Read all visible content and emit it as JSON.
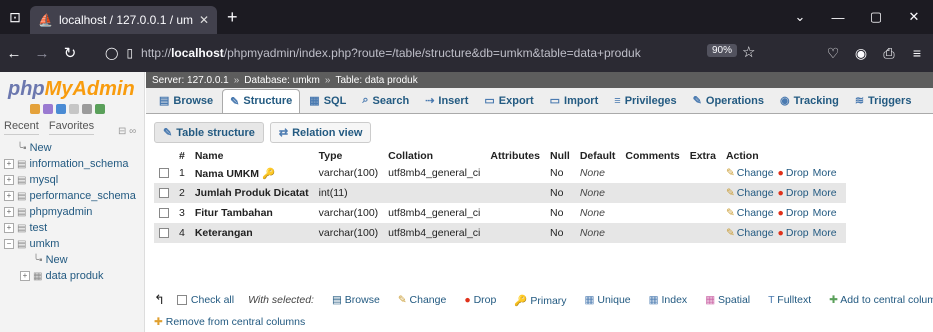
{
  "browser": {
    "tab_title": "localhost / 127.0.0.1 / umkm / d",
    "url_prefix": "http://",
    "url_host": "localhost",
    "url_path": "/phpmyadmin/index.php?route=/table/structure&db=umkm&table=data+produk",
    "zoom": "90%"
  },
  "sidebar": {
    "logo_a": "php",
    "logo_b": "MyAdmin",
    "recent": "Recent",
    "favorites": "Favorites",
    "items": [
      {
        "label": "New"
      },
      {
        "label": "information_schema"
      },
      {
        "label": "mysql"
      },
      {
        "label": "performance_schema"
      },
      {
        "label": "phpmyadmin"
      },
      {
        "label": "test"
      },
      {
        "label": "umkm"
      }
    ],
    "sub": [
      {
        "label": "New"
      },
      {
        "label": "data produk"
      }
    ]
  },
  "breadcrumb": {
    "server": "Server: 127.0.0.1",
    "database": "Database: umkm",
    "table": "Table: data produk"
  },
  "menu": {
    "browse": "Browse",
    "structure": "Structure",
    "sql": "SQL",
    "search": "Search",
    "insert": "Insert",
    "export": "Export",
    "import": "Import",
    "privileges": "Privileges",
    "operations": "Operations",
    "tracking": "Tracking",
    "triggers": "Triggers"
  },
  "subtabs": {
    "table_structure": "Table structure",
    "relation_view": "Relation view"
  },
  "columns": {
    "num": "#",
    "name": "Name",
    "type": "Type",
    "collation": "Collation",
    "attributes": "Attributes",
    "null": "Null",
    "default": "Default",
    "comments": "Comments",
    "extra": "Extra",
    "action": "Action"
  },
  "rows": [
    {
      "n": "1",
      "name": "Nama UMKM",
      "type": "varchar(100)",
      "collation": "utf8mb4_general_ci",
      "null": "No",
      "default": "None"
    },
    {
      "n": "2",
      "name": "Jumlah Produk Dicatat",
      "type": "int(11)",
      "collation": "",
      "null": "No",
      "default": "None"
    },
    {
      "n": "3",
      "name": "Fitur Tambahan",
      "type": "varchar(100)",
      "collation": "utf8mb4_general_ci",
      "null": "No",
      "default": "None"
    },
    {
      "n": "4",
      "name": "Keterangan",
      "type": "varchar(100)",
      "collation": "utf8mb4_general_ci",
      "null": "No",
      "default": "None"
    }
  ],
  "actions": {
    "change": "Change",
    "drop": "Drop",
    "more": "More"
  },
  "bulk": {
    "check_all": "Check all",
    "with_selected": "With selected:",
    "browse": "Browse",
    "change": "Change",
    "drop": "Drop",
    "primary": "Primary",
    "unique": "Unique",
    "index": "Index",
    "spatial": "Spatial",
    "fulltext": "Fulltext",
    "add_central": "Add to central columns",
    "remove_central": "Remove from central columns"
  }
}
